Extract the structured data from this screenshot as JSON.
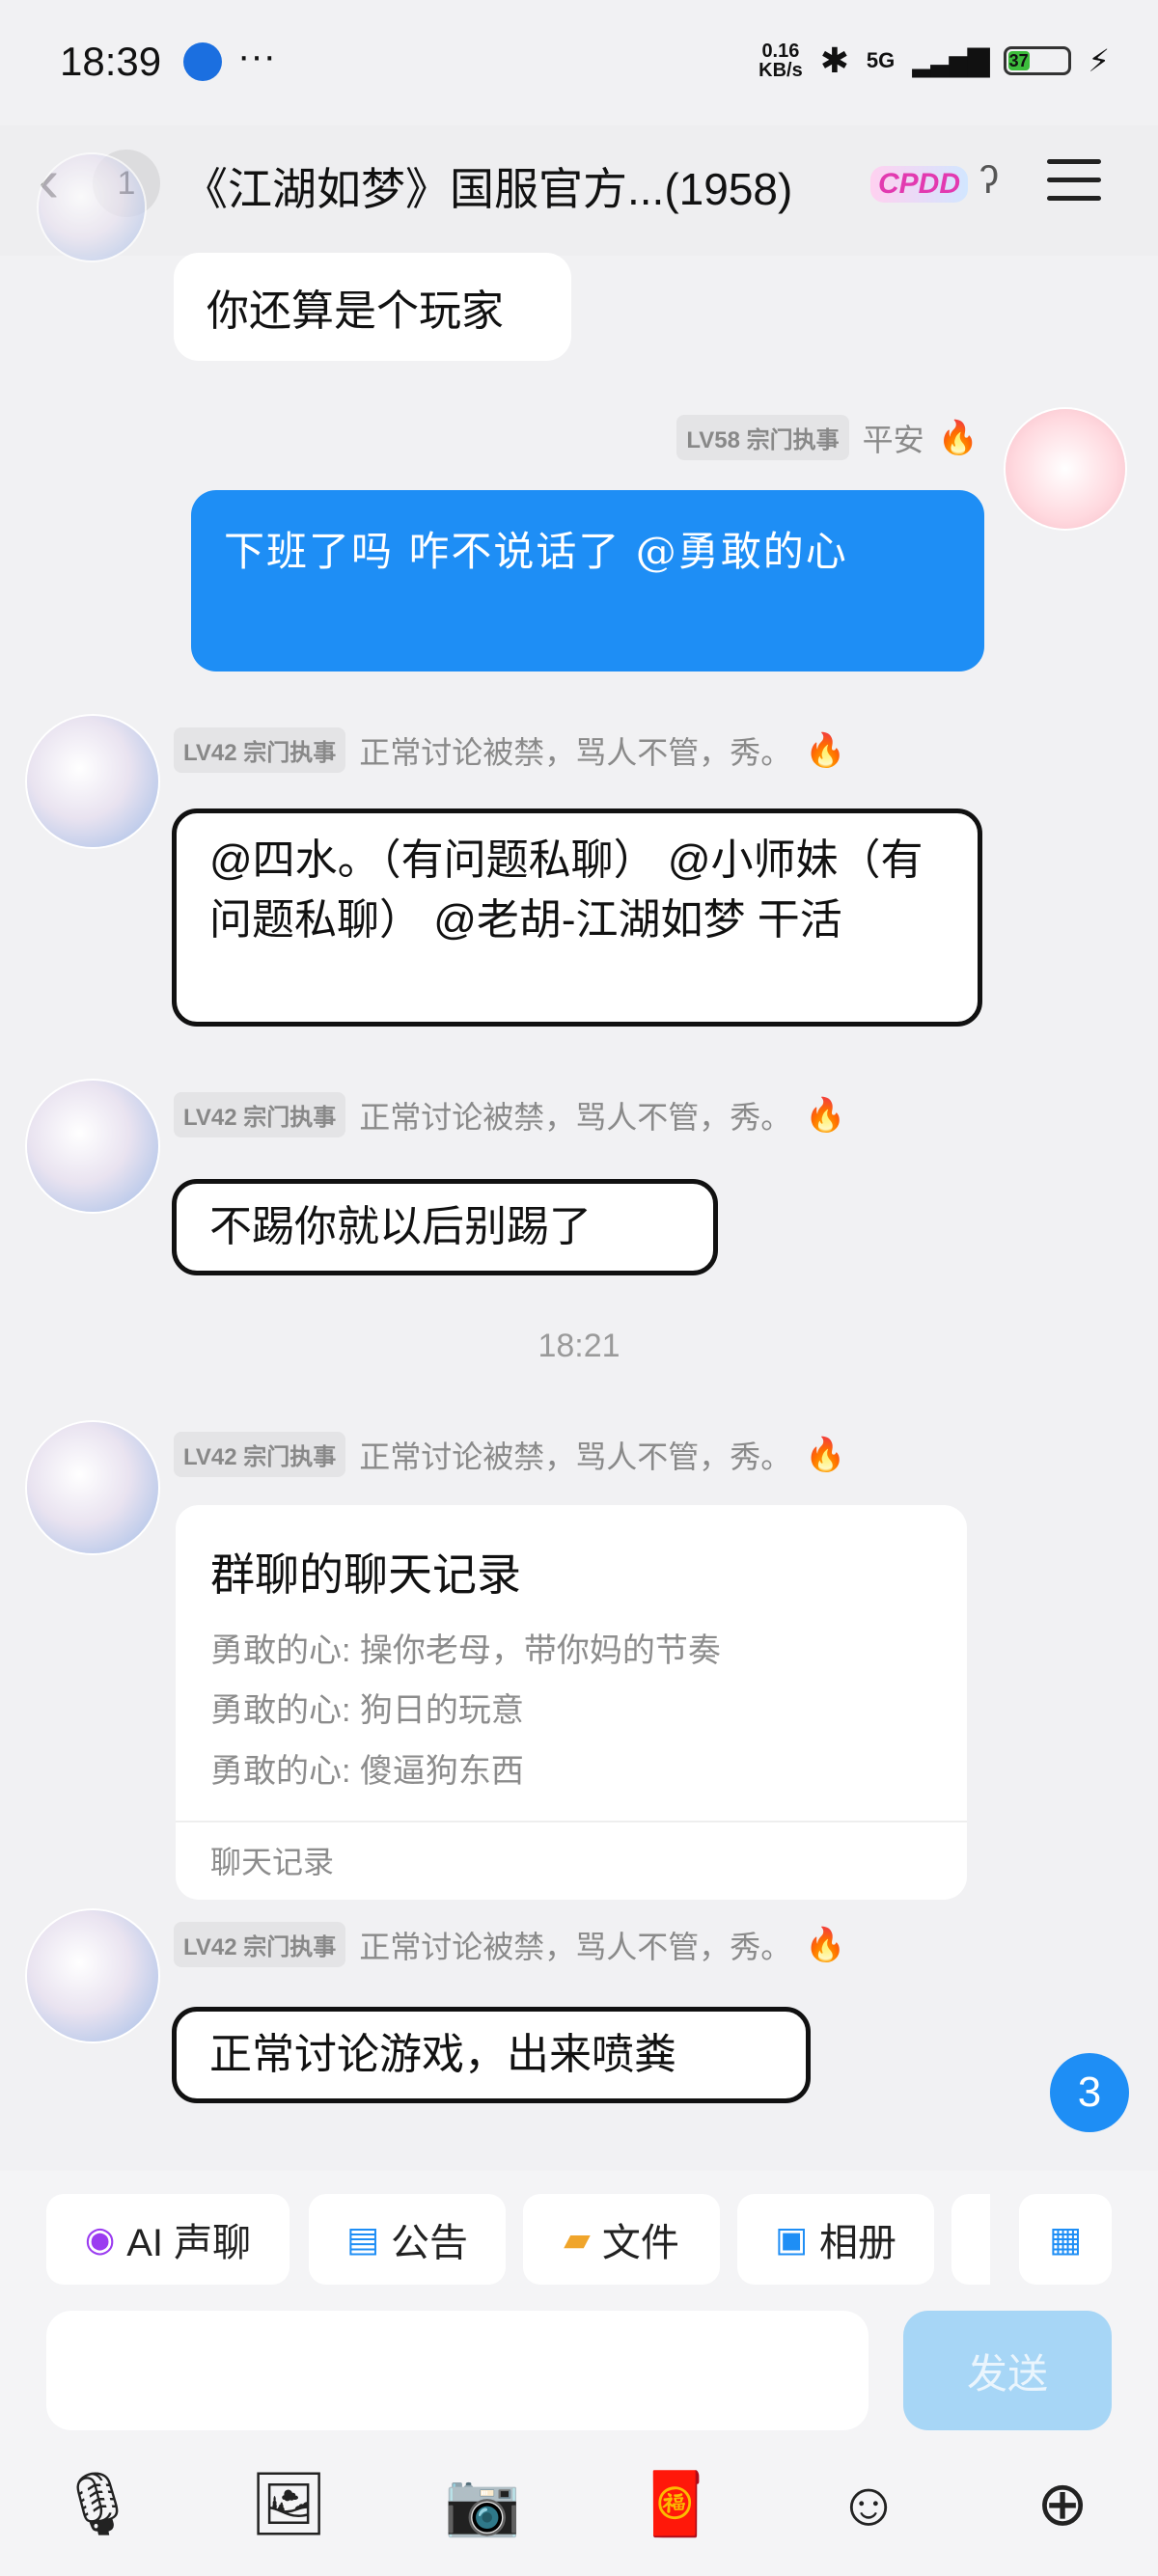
{
  "status_bar": {
    "time": "18:39",
    "dots": "···",
    "net_speed_top": "0.16",
    "net_speed_bottom": "KB/s",
    "network": "5G",
    "battery": "37"
  },
  "header": {
    "back_badge": "1",
    "title": "《江湖如梦》国服官方...(1958)",
    "brand_tag": "CPDD"
  },
  "messages": {
    "partial_text": "你还算是个玩家",
    "self_level": "LV58 宗门执事",
    "self_name": "平安",
    "self_text": "下班了吗  咋不说话了 @勇敢的心",
    "sender_level": "LV42 宗门执事",
    "sender_name": "正常讨论被禁，骂人不管，秀。",
    "msg1": "@四水。（有问题私聊） @小师妹（有问题私聊） @老胡-江湖如梦 干活",
    "msg2": "不踢你就以后别踢了",
    "timestamp": "18:21",
    "card_title": "群聊的聊天记录",
    "card_lines": [
      "勇敢的心: 操你老母，带你妈的节奏",
      "勇敢的心: 狗日的玩意",
      "勇敢的心: 傻逼狗东西"
    ],
    "card_footer": "聊天记录",
    "msg3": "正常讨论游戏，出来喷粪"
  },
  "unread_count": "3",
  "quick_actions": [
    "AI 声聊",
    "公告",
    "文件",
    "相册"
  ],
  "input": {
    "send_label": "发送"
  },
  "icons": [
    "mic-icon",
    "image-icon",
    "camera-icon",
    "red-packet-icon",
    "emoji-icon",
    "plus-icon"
  ],
  "colors": {
    "accent": "#1e8ef5",
    "send_disabled": "#a7d6f6",
    "fire": "#f06a2b"
  }
}
